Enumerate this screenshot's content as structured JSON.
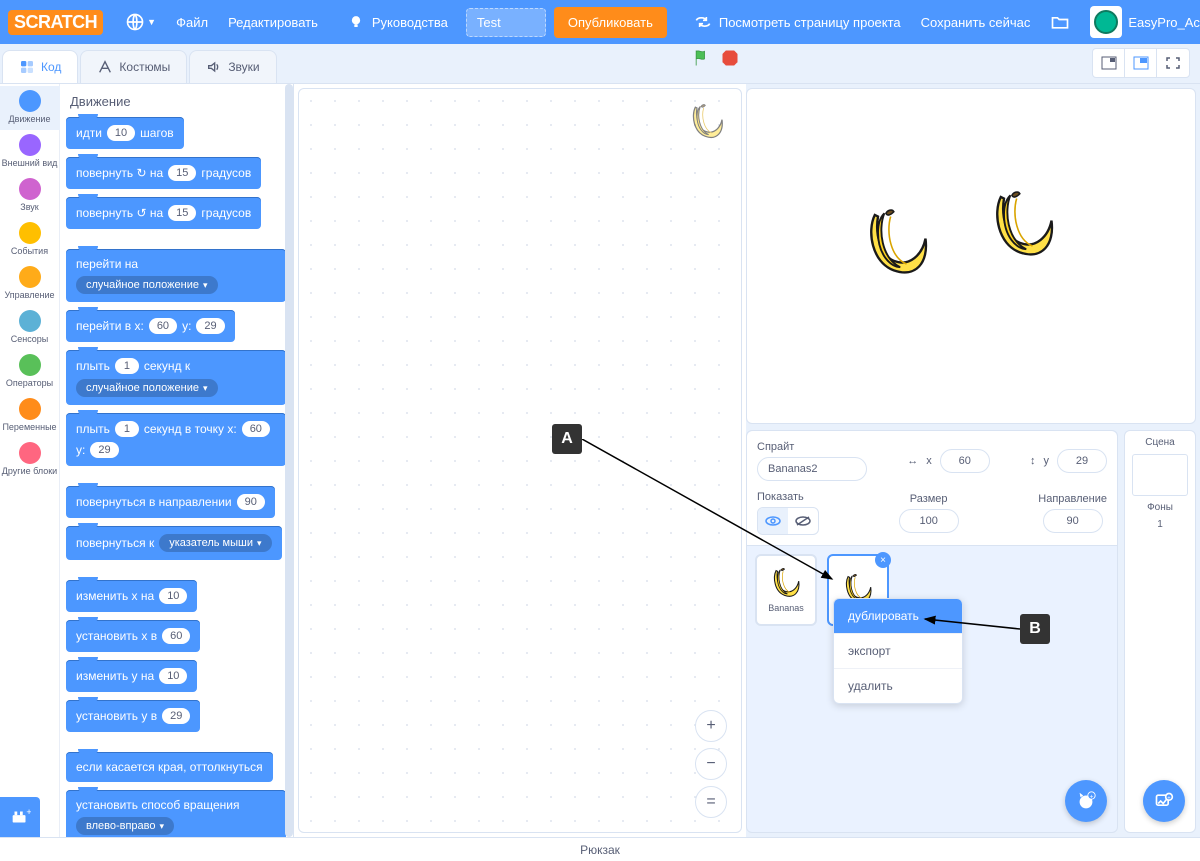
{
  "menubar": {
    "file": "Файл",
    "edit": "Редактировать",
    "tutorials": "Руководства",
    "project_name": "Test",
    "publish": "Опубликовать",
    "see_project_page": "Посмотреть страницу проекта",
    "save_now": "Сохранить сейчас",
    "username": "EasyPro_Academy"
  },
  "tabs": {
    "code": "Код",
    "costumes": "Костюмы",
    "sounds": "Звуки"
  },
  "categories": [
    {
      "name": "Движение",
      "color": "#4c97ff"
    },
    {
      "name": "Внешний вид",
      "color": "#9966ff"
    },
    {
      "name": "Звук",
      "color": "#cf63cf"
    },
    {
      "name": "События",
      "color": "#ffbf00"
    },
    {
      "name": "Управление",
      "color": "#ffab19"
    },
    {
      "name": "Сенсоры",
      "color": "#5cb1d6"
    },
    {
      "name": "Операторы",
      "color": "#59c059"
    },
    {
      "name": "Переменные",
      "color": "#ff8c1a"
    },
    {
      "name": "Другие блоки",
      "color": "#ff6680"
    }
  ],
  "palette": {
    "header": "Движение",
    "blocks": {
      "move_steps_pre": "идти",
      "move_steps_val": "10",
      "move_steps_post": "шагов",
      "turn_cw_pre": "повернуть ↻ на",
      "turn_cw_val": "15",
      "turn_cw_post": "градусов",
      "turn_ccw_pre": "повернуть ↺ на",
      "turn_ccw_val": "15",
      "turn_ccw_post": "градусов",
      "goto_pre": "перейти на",
      "goto_menu": "случайное положение",
      "gotoxy_pre": "перейти в x:",
      "gotoxy_x": "60",
      "gotoxy_mid": "y:",
      "gotoxy_y": "29",
      "glide_pre": "плыть",
      "glide_secs": "1",
      "glide_mid": "секунд к",
      "glide_menu": "случайное положение",
      "glidexy_pre": "плыть",
      "glidexy_secs": "1",
      "glidexy_mid": "секунд в точку x:",
      "glidexy_x": "60",
      "glidexy_mid2": "y:",
      "glidexy_y": "29",
      "point_dir_pre": "повернуться в направлении",
      "point_dir_val": "90",
      "point_towards_pre": "повернуться к",
      "point_towards_menu": "указатель мыши",
      "change_x_pre": "изменить x на",
      "change_x_val": "10",
      "set_x_pre": "установить x в",
      "set_x_val": "60",
      "change_y_pre": "изменить y на",
      "change_y_val": "10",
      "set_y_pre": "установить y в",
      "set_y_val": "29",
      "bounce": "если касается края, оттолкнуться",
      "rotation_pre": "установить способ вращения",
      "rotation_menu": "влево-вправо"
    }
  },
  "sprite_info": {
    "label_sprite": "Спрайт",
    "name": "Bananas2",
    "label_x": "x",
    "x": "60",
    "label_y": "y",
    "y": "29",
    "label_show": "Показать",
    "label_size": "Размер",
    "size": "100",
    "label_direction": "Направление",
    "direction": "90"
  },
  "sprites": {
    "tile1": "Bananas"
  },
  "context_menu": {
    "duplicate": "дублировать",
    "export": "экспорт",
    "delete": "удалить"
  },
  "scene": {
    "label": "Сцена",
    "backdrops_label": "Фоны",
    "backdrops_count": "1"
  },
  "backpack": "Рюкзак",
  "annotations": {
    "a": "A",
    "b": "B"
  }
}
